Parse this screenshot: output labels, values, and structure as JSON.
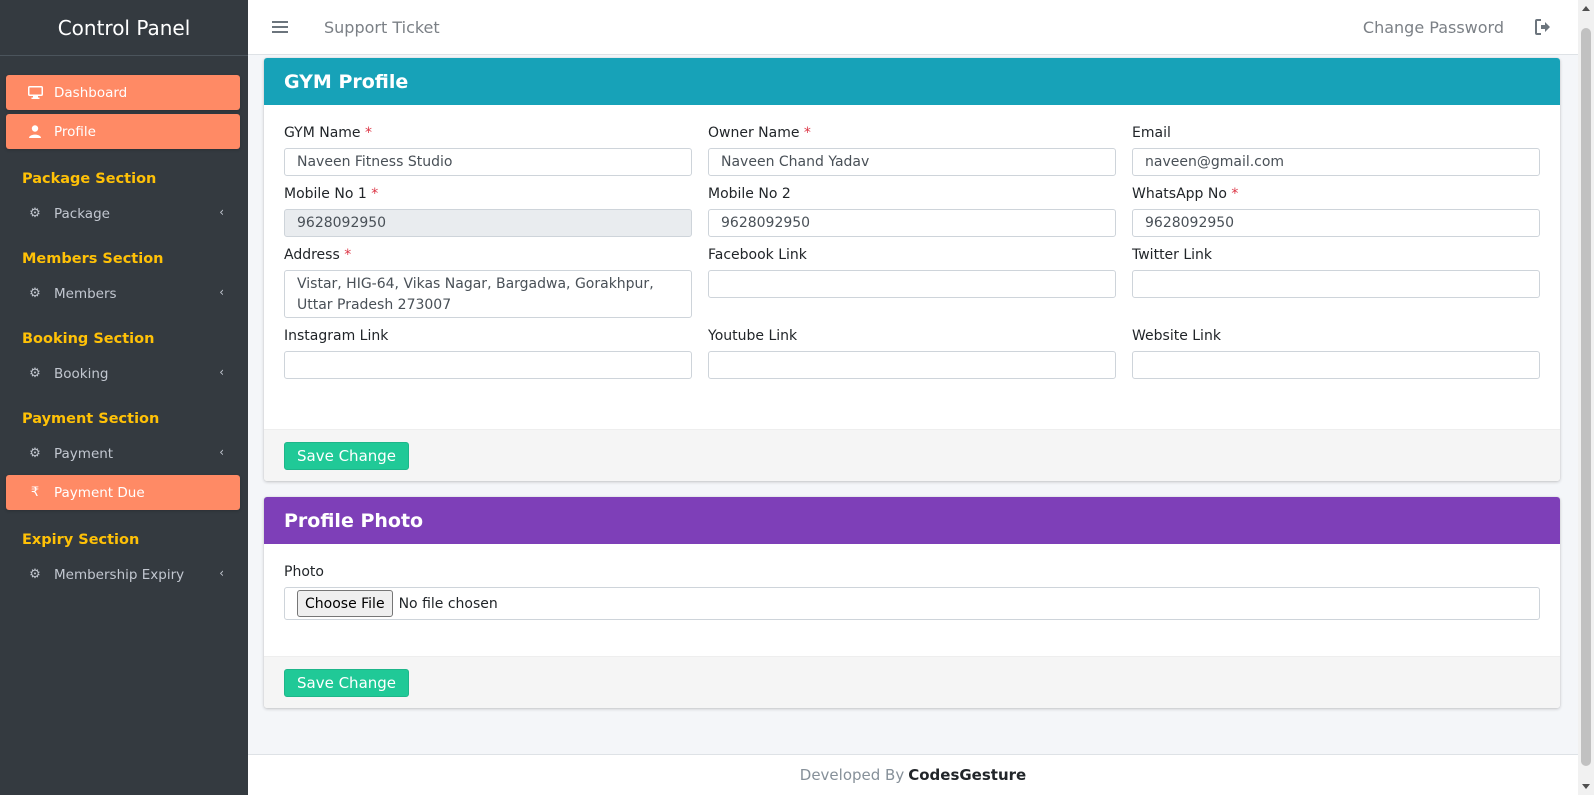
{
  "sidebar": {
    "brand": "Control Panel",
    "items": {
      "dashboard": "Dashboard",
      "profile": "Profile",
      "package_header": "Package Section",
      "package": "Package",
      "members_header": "Members Section",
      "members": "Members",
      "booking_header": "Booking Section",
      "booking": "Booking",
      "payment_header": "Payment Section",
      "payment": "Payment",
      "payment_due": "Payment Due",
      "expiry_header": "Expiry Section",
      "membership_expiry": "Membership Expiry"
    }
  },
  "topbar": {
    "support_ticket": "Support Ticket",
    "change_password": "Change Password"
  },
  "gym_profile": {
    "title": "GYM Profile",
    "fields": {
      "gym_name": {
        "label": "GYM Name",
        "value": "Naveen Fitness Studio"
      },
      "owner_name": {
        "label": "Owner Name",
        "value": "Naveen Chand Yadav"
      },
      "email": {
        "label": "Email",
        "value": "naveen@gmail.com"
      },
      "mobile1": {
        "label": "Mobile No 1",
        "value": "9628092950"
      },
      "mobile2": {
        "label": "Mobile No 2",
        "value": "9628092950"
      },
      "whatsapp": {
        "label": "WhatsApp No",
        "value": "9628092950"
      },
      "address": {
        "label": "Address",
        "value": "Vistar, HIG-64, Vikas Nagar, Bargadwa, Gorakhpur, Uttar Pradesh 273007"
      },
      "facebook": {
        "label": "Facebook Link",
        "value": ""
      },
      "twitter": {
        "label": "Twitter Link",
        "value": ""
      },
      "instagram": {
        "label": "Instagram Link",
        "value": ""
      },
      "youtube": {
        "label": "Youtube Link",
        "value": ""
      },
      "website": {
        "label": "Website Link",
        "value": ""
      }
    },
    "required_mark": "*",
    "save_label": "Save Change"
  },
  "profile_photo": {
    "title": "Profile Photo",
    "photo_label": "Photo",
    "choose_file": "Choose File",
    "file_status": "No file chosen",
    "save_label": "Save Change"
  },
  "footer": {
    "prefix": "Developed By",
    "brand": "CodesGesture"
  },
  "colors": {
    "sidebar_bg": "#343a40",
    "active_item": "#ff8a65",
    "section_header": "#ffc107",
    "gym_header": "#17a2b8",
    "photo_header": "#7e3fb8",
    "save_button": "#20c997"
  }
}
